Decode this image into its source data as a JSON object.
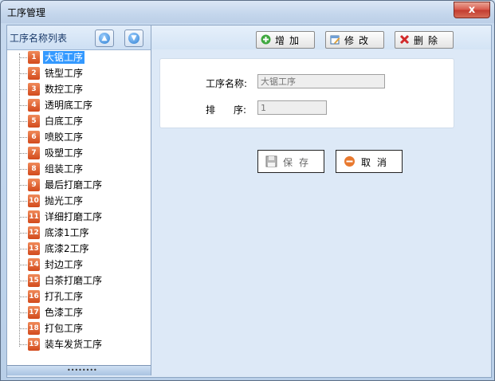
{
  "window": {
    "title": "工序管理",
    "close_label": "x"
  },
  "left_panel": {
    "title": "工序名称列表",
    "up_icon": "arrow-up-icon",
    "down_icon": "arrow-down-icon",
    "items": [
      {
        "num": "1",
        "label": "大锯工序"
      },
      {
        "num": "2",
        "label": "铣型工序"
      },
      {
        "num": "3",
        "label": "数控工序"
      },
      {
        "num": "4",
        "label": "透明底工序"
      },
      {
        "num": "5",
        "label": "白底工序"
      },
      {
        "num": "6",
        "label": "喷胶工序"
      },
      {
        "num": "7",
        "label": "吸塑工序"
      },
      {
        "num": "8",
        "label": "组装工序"
      },
      {
        "num": "9",
        "label": "最后打磨工序"
      },
      {
        "num": "10",
        "label": "抛光工序"
      },
      {
        "num": "11",
        "label": "详细打磨工序"
      },
      {
        "num": "12",
        "label": "底漆1工序"
      },
      {
        "num": "13",
        "label": "底漆2工序"
      },
      {
        "num": "14",
        "label": "封边工序"
      },
      {
        "num": "15",
        "label": "白茶打磨工序"
      },
      {
        "num": "16",
        "label": "打孔工序"
      },
      {
        "num": "17",
        "label": "色漆工序"
      },
      {
        "num": "18",
        "label": "打包工序"
      },
      {
        "num": "19",
        "label": "装车发货工序"
      }
    ],
    "selected_index": 0,
    "footer_grip": "••••••••"
  },
  "toolbar": {
    "add_label": "增加",
    "edit_label": "修改",
    "delete_label": "删除"
  },
  "form": {
    "name_label": "工序名称:",
    "name_value": "大锯工序",
    "order_label_a": "排",
    "order_label_b": "序:",
    "order_value": "1"
  },
  "actions": {
    "save_label": "保存",
    "cancel_label": "取消"
  },
  "colors": {
    "selection": "#3399ff",
    "badge": "#e0622f",
    "close": "#c9463a"
  }
}
